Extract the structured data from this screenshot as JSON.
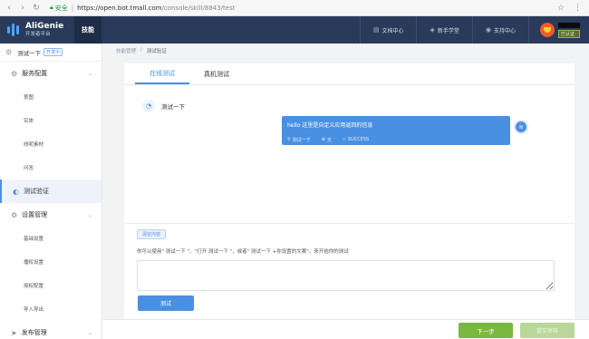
{
  "browser": {
    "secure_label": "安全",
    "url_host": "https://open.bot.tmall.com",
    "url_path": "/console/skill/8843/test"
  },
  "header": {
    "logo_name": "AliGenie",
    "logo_sub": "开发者平台",
    "tab_label": "技能",
    "links": [
      {
        "label": "文档中心",
        "icon": "document-icon"
      },
      {
        "label": "新手学堂",
        "icon": "graduation-icon"
      },
      {
        "label": "支持中心",
        "icon": "headset-icon"
      }
    ],
    "user_tag": "已认证"
  },
  "sidebar": {
    "skill_name": "测试一下",
    "skill_tag": "开发中",
    "groups": [
      {
        "label": "服务配置",
        "items": [
          "意图",
          "实体",
          "线呢素材",
          "问答"
        ]
      },
      {
        "label": "测试验证",
        "items": []
      },
      {
        "label": "设置管理",
        "items": [
          "基础设置",
          "播权设置",
          "授权配置",
          "导入导出"
        ]
      },
      {
        "label": "发布管理",
        "items": []
      }
    ]
  },
  "breadcrumb": {
    "parent": "技能管理",
    "current": "测试验证"
  },
  "tabs": {
    "online": "在线测试",
    "device": "真机测试"
  },
  "chat": {
    "user_message": "测试一下",
    "reply_text": "hello 这里是自定义应用返回的信息",
    "meta_skill": "测试一下",
    "meta_intent": "天",
    "meta_status": "SUCCESS"
  },
  "input": {
    "clear_label": "清空内容",
    "hint": "你可以使用\" 测试一下 \"、\"打开 测试一下 \"，或者\" 测试一下 +你设置的文案\"，来开始你的测试",
    "placeholder": "",
    "test_label": "测试"
  },
  "footer": {
    "next_label": "下一步",
    "submit_label": "提交审核"
  },
  "colors": {
    "accent": "#4a90e2",
    "header_bg": "#2a3a5a",
    "next_green": "#7ab840"
  }
}
